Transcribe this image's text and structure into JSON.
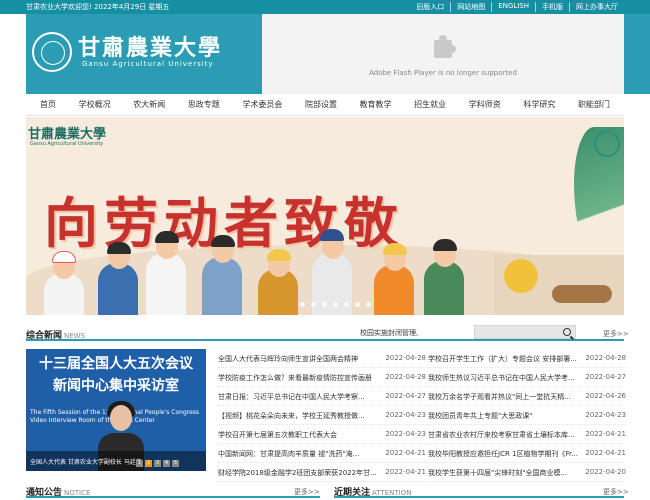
{
  "topbar": {
    "welcome": "甘肃农业大学欢迎您! 2022年4月29日 星期五",
    "links": [
      "旧版入口",
      "网站地图",
      "ENGLISH",
      "手机版",
      "网上办事大厅"
    ]
  },
  "header": {
    "logo_cn": "甘肅農業大學",
    "logo_en": "Gansu Agricultural University",
    "flash_message": "Adobe Flash Player is no longer supported"
  },
  "nav": {
    "items": [
      "首页",
      "学校概况",
      "农大新闻",
      "思政专题",
      "学术委员会",
      "院部设置",
      "教育教学",
      "招生就业",
      "学科师资",
      "科学研究",
      "职能部门"
    ]
  },
  "banner": {
    "logo_cn": "甘肅農業大學",
    "logo_en": "Gansu Agricultural University",
    "slogan": "向劳动者致敬"
  },
  "news": {
    "title": "综合新闻",
    "title_en": "NEWS",
    "ticker": "校园实施封闭管理,",
    "more": "更多>>",
    "photo": {
      "line1": "十三届全国人大五次会议",
      "line2": "新闻中心集中采访室",
      "en": "The Fifth Session of the 13th National People's Congress Video Interview Room of the Press Center",
      "caption": "全国人大代表 甘肃农业大学副校长 马廷荣"
    },
    "left_list": [
      {
        "title": "全国人大代表马辉玲向师生宣讲全国两会精神",
        "date": "2022-04-28"
      },
      {
        "title": "学校防疫工作怎么做？来看最新疫情防控宣传画册",
        "date": "2022-04-28"
      },
      {
        "title": "甘肃日报：习近平总书记在中国人民大学考察...",
        "date": "2022-04-27"
      },
      {
        "title": "【视频】桃花朵朵向未来，学校王延秀教授做...",
        "date": "2022-04-23"
      },
      {
        "title": "学校召开第七届第五次教职工代表大会",
        "date": "2022-04-23"
      },
      {
        "title": "中国新闻网：甘肃提高肉羊质量 褪\"洗药\"淹...",
        "date": "2022-04-21"
      },
      {
        "title": "财经学院2018级金融学2班团支部荣获2022年甘...",
        "date": "2022-04-21"
      }
    ],
    "right_list": [
      {
        "title": "学校召开学生工作（扩大）专题会议 安排部署...",
        "date": "2022-04-28"
      },
      {
        "title": "我校师生热议习近平总书记在中国人民大学考...",
        "date": "2022-04-27"
      },
      {
        "title": "我校万余名学子观看并热议\"同上一堂抗天精...",
        "date": "2022-04-26"
      },
      {
        "title": "我校团员青年共上专题\"大思政课\"",
        "date": "2022-04-23"
      },
      {
        "title": "甘肃省农业农村厅来校考察甘肃省土壤标本库...",
        "date": "2022-04-21"
      },
      {
        "title": "我校毕阳教授应邀担任JCR 1区植物学期刊《Fr...",
        "date": "2022-04-21"
      },
      {
        "title": "我校学生获第十四届\"尖锋时刻\"全国商业模...",
        "date": "2022-04-20"
      }
    ]
  },
  "notice": {
    "title": "通知公告",
    "title_en": "NOTICE",
    "more": "更多>>"
  },
  "recent": {
    "title": "近期关注",
    "title_en": "ATTENTION",
    "more": "更多>>"
  },
  "colors": {
    "brand": "#2a9db4",
    "topbar": "#178fa3",
    "slogan": "#c8322e"
  }
}
